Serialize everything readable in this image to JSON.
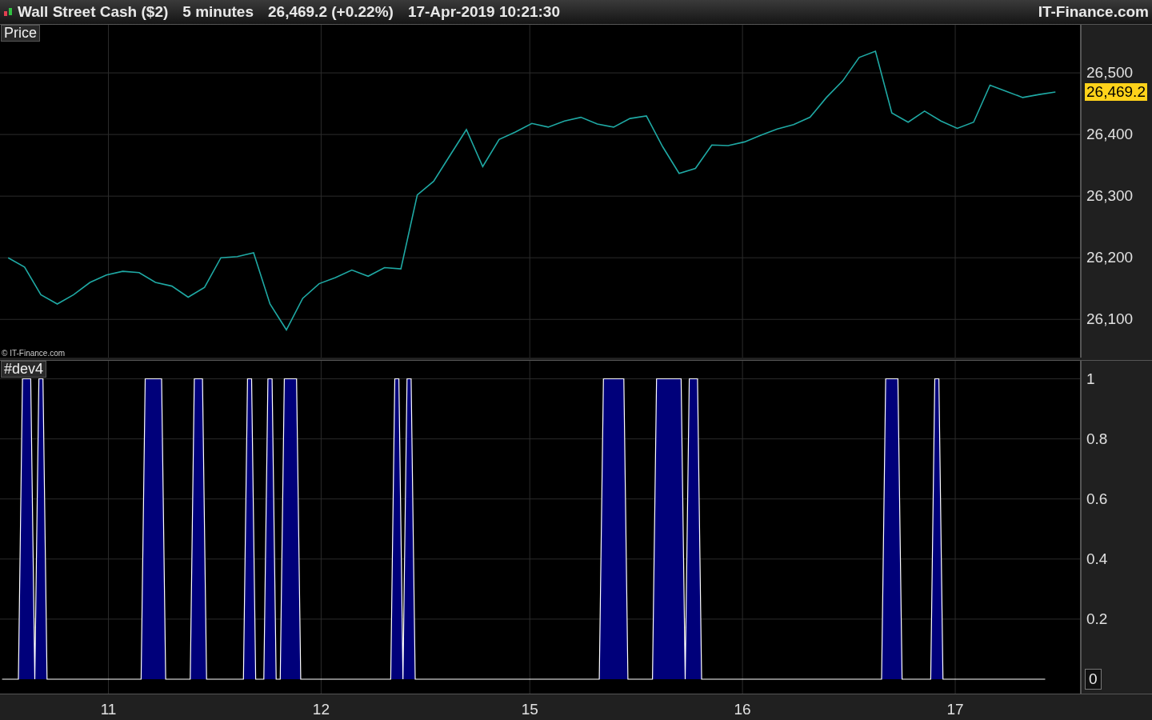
{
  "header": {
    "instrument": "Wall Street Cash ($2)",
    "interval": "5 minutes",
    "quote": "26,469.2 (+0.22%)",
    "datetime": "17-Apr-2019 10:21:30",
    "brand": "IT-Finance.com"
  },
  "price_panel": {
    "credit": "© IT-Finance.com",
    "last_price": "26,469.2",
    "chart_data": {
      "type": "line",
      "grid": true,
      "categories": [
        null,
        null,
        null,
        null,
        null,
        null,
        null,
        null,
        null,
        null,
        null,
        null,
        null,
        null,
        null,
        null,
        null,
        null,
        null,
        null,
        null,
        null,
        null,
        null,
        null,
        null,
        null,
        null,
        null,
        null,
        null,
        null,
        null,
        null,
        null,
        null,
        null,
        null,
        null,
        null,
        null,
        null,
        null,
        null,
        null,
        null,
        null,
        null,
        null,
        null,
        null,
        null,
        null,
        null,
        null,
        null,
        null,
        null,
        null,
        null,
        null,
        null,
        null,
        null,
        null,
        null
      ],
      "series": [
        {
          "name": "Price",
          "color": "#1fa9a4",
          "values": [
            26200,
            26185,
            26140,
            26125,
            26140,
            26160,
            26172,
            26178,
            26176,
            26160,
            26154,
            26136,
            26152,
            26200,
            26202,
            26208,
            26125,
            26083,
            26134,
            26158,
            26168,
            26180,
            26170,
            26184,
            26182,
            26302,
            26324,
            26366,
            26408,
            26348,
            26392,
            26404,
            26418,
            26412,
            26422,
            26428,
            26417,
            26412,
            26426,
            26430,
            26380,
            26337,
            26345,
            26383,
            26382,
            26388,
            26399,
            26409,
            26416,
            26428,
            26460,
            26487,
            26525,
            26535,
            26435,
            26420,
            26438,
            26422,
            26410,
            26420,
            26480,
            26470,
            26460,
            26465,
            26469,
            null
          ]
        }
      ],
      "ylim": [
        26038,
        26578
      ],
      "yticks": [
        {
          "value": 26100,
          "label": "26,100"
        },
        {
          "value": 26200,
          "label": "26,200"
        },
        {
          "value": 26300,
          "label": "26,300"
        },
        {
          "value": 26400,
          "label": "26,400"
        },
        {
          "value": 26500,
          "label": "26,500"
        }
      ]
    }
  },
  "indicator_panel": {
    "last_value": "0",
    "chart_data": {
      "type": "area",
      "grid": true,
      "categories": [
        null,
        null,
        null,
        null,
        null,
        null,
        null,
        null,
        null,
        null,
        null,
        null,
        null,
        null,
        null,
        null,
        null,
        null,
        null,
        null,
        null,
        null,
        null,
        null,
        null,
        null,
        "11",
        null,
        null,
        null,
        null,
        null,
        null,
        null,
        null,
        null,
        null,
        null,
        null,
        null,
        null,
        null,
        null,
        null,
        null,
        null,
        null,
        null,
        null,
        null,
        null,
        null,
        null,
        null,
        null,
        null,
        null,
        null,
        null,
        null,
        null,
        null,
        null,
        null,
        null,
        null,
        null,
        null,
        null,
        null,
        null,
        null,
        null,
        null,
        null,
        null,
        null,
        null,
        "12",
        null,
        null,
        null,
        null,
        null,
        null,
        null,
        null,
        null,
        null,
        null,
        null,
        null,
        null,
        null,
        null,
        null,
        null,
        null,
        null,
        null,
        null,
        null,
        null,
        null,
        null,
        null,
        null,
        null,
        null,
        null,
        null,
        null,
        null,
        null,
        null,
        null,
        null,
        null,
        null,
        null,
        null,
        null,
        null,
        null,
        null,
        null,
        null,
        null,
        null,
        "15",
        null,
        null,
        null,
        null,
        null,
        null,
        null,
        null,
        null,
        null,
        null,
        null,
        null,
        null,
        null,
        null,
        null,
        null,
        null,
        null,
        null,
        null,
        null,
        null,
        null,
        null,
        null,
        null,
        null,
        null,
        null,
        null,
        null,
        null,
        null,
        null,
        null,
        null,
        null,
        null,
        null,
        null,
        null,
        null,
        null,
        null,
        null,
        null,
        null,
        null,
        null,
        "16",
        null,
        null,
        null,
        null,
        null,
        null,
        null,
        null,
        null,
        null,
        null,
        null,
        null,
        null,
        null,
        null,
        null,
        null,
        null,
        null,
        null,
        null,
        null,
        null,
        null,
        null,
        null,
        null,
        null,
        null,
        null,
        null,
        null,
        null,
        null,
        null,
        null,
        null,
        null,
        null,
        null,
        null,
        null,
        null,
        null,
        null,
        null,
        null,
        null,
        null,
        null,
        "17",
        null,
        null,
        null,
        null,
        null,
        null,
        null,
        null,
        null,
        null,
        null,
        null,
        null,
        null,
        null,
        null,
        null,
        null,
        null,
        null,
        null,
        null,
        null,
        null,
        null,
        null,
        null,
        null,
        null,
        null
      ],
      "series": [
        {
          "name": "#dev4",
          "color": "#00007a",
          "values": [
            0,
            0,
            0,
            0,
            0,
            1,
            1,
            1,
            0,
            1,
            1,
            0,
            0,
            0,
            0,
            0,
            0,
            0,
            0,
            0,
            0,
            0,
            0,
            0,
            0,
            0,
            0,
            0,
            0,
            0,
            0,
            0,
            0,
            0,
            0,
            1,
            1,
            1,
            1,
            1,
            0,
            0,
            0,
            0,
            0,
            0,
            0,
            1,
            1,
            1,
            0,
            0,
            0,
            0,
            0,
            0,
            0,
            0,
            0,
            0,
            1,
            1,
            0,
            0,
            0,
            1,
            1,
            0,
            0,
            1,
            1,
            1,
            1,
            0,
            0,
            0,
            0,
            0,
            0,
            0,
            0,
            0,
            0,
            0,
            0,
            0,
            0,
            0,
            0,
            0,
            0,
            0,
            0,
            0,
            0,
            0,
            1,
            1,
            0,
            1,
            1,
            0,
            0,
            0,
            0,
            0,
            0,
            0,
            0,
            0,
            0,
            0,
            0,
            0,
            0,
            0,
            0,
            0,
            0,
            0,
            0,
            0,
            0,
            0,
            0,
            0,
            0,
            0,
            0,
            0,
            0,
            0,
            0,
            0,
            0,
            0,
            0,
            0,
            0,
            0,
            0,
            0,
            0,
            0,
            0,
            0,
            0,
            1,
            1,
            1,
            1,
            1,
            1,
            0,
            0,
            0,
            0,
            0,
            0,
            0,
            1,
            1,
            1,
            1,
            1,
            1,
            1,
            0,
            1,
            1,
            1,
            0,
            0,
            0,
            0,
            0,
            0,
            0,
            0,
            0,
            0,
            0,
            0,
            0,
            0,
            0,
            0,
            0,
            0,
            0,
            0,
            0,
            0,
            0,
            0,
            0,
            0,
            0,
            0,
            0,
            0,
            0,
            0,
            0,
            0,
            0,
            0,
            0,
            0,
            0,
            0,
            0,
            0,
            0,
            0,
            0,
            1,
            1,
            1,
            1,
            0,
            0,
            0,
            0,
            0,
            0,
            0,
            0,
            1,
            1,
            0,
            0,
            0,
            0,
            0,
            0,
            0,
            0,
            0,
            0,
            0,
            0,
            0,
            0,
            0,
            0,
            0,
            0,
            0,
            0,
            0,
            0,
            0,
            0,
            0,
            0,
            null,
            null,
            null,
            null,
            null,
            null,
            null,
            null
          ]
        }
      ],
      "ylim": [
        -0.048,
        1.06
      ],
      "yticks": [
        {
          "value": 0.2,
          "label": "0.2"
        },
        {
          "value": 0.4,
          "label": "0.4"
        },
        {
          "value": 0.6,
          "label": "0.6"
        },
        {
          "value": 0.8,
          "label": "0.8"
        },
        {
          "value": 1,
          "label": "1"
        }
      ]
    }
  }
}
